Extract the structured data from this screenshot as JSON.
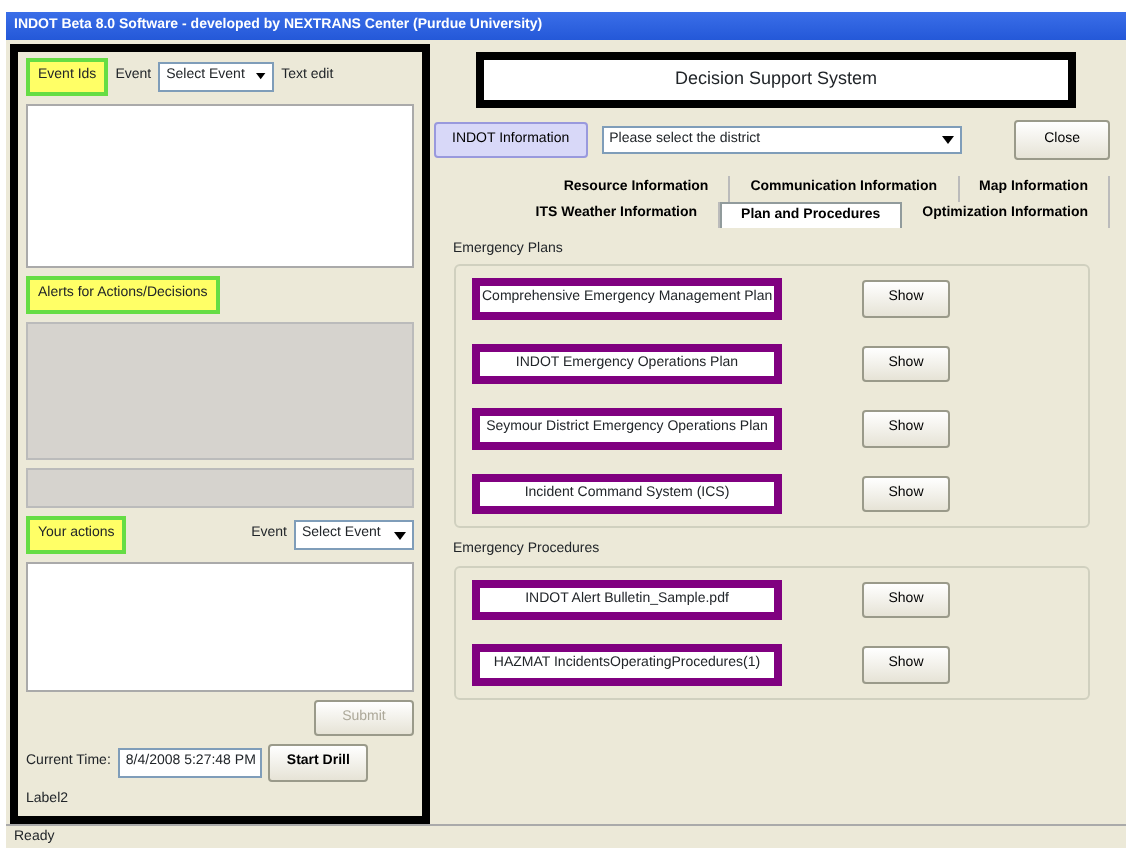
{
  "window": {
    "title": "INDOT Beta 8.0 Software - developed by NEXTRANS Center (Purdue University)"
  },
  "left_panel": {
    "events_label": "Event Ids",
    "event_label": "Event",
    "event_select": "Select Event",
    "text_label": "Text edit",
    "alerts_label": "Alerts for Actions/Decisions",
    "actions_label": "Your actions",
    "actions_event_label": "Event",
    "actions_event_select": "Select Event",
    "submit": {
      "label": "Submit",
      "disabled": true
    },
    "time_label": "Current Time:",
    "time_value": "8/4/2008 5:27:48 PM",
    "start_button": "Start Drill",
    "footer_label": "Label2"
  },
  "header": {
    "title": "Decision Support System",
    "info_button": "INDOT Information",
    "district_select": "Please select the district",
    "close_button": "Close"
  },
  "tab_rows": [
    [
      {
        "label": "Resource Information",
        "selected": false
      },
      {
        "label": "Communication Information",
        "selected": false
      },
      {
        "label": "Map Information",
        "selected": false
      }
    ],
    [
      {
        "label": "ITS Weather Information",
        "selected": false
      },
      {
        "label": "Plan and Procedures",
        "selected": true
      },
      {
        "label": "Optimization Information",
        "selected": false
      }
    ]
  ],
  "groups": [
    {
      "title": "Emergency Plans",
      "items": [
        {
          "name": "Comprehensive Emergency Management Plan",
          "button": "Show"
        },
        {
          "name": "INDOT Emergency Operations Plan",
          "button": "Show"
        },
        {
          "name": "Seymour District Emergency Operations Plan",
          "button": "Show"
        },
        {
          "name": "Incident Command System (ICS)",
          "button": "Show"
        }
      ]
    },
    {
      "title": "Emergency Procedures",
      "items": [
        {
          "name": "INDOT Alert Bulletin_Sample.pdf",
          "button": "Show"
        },
        {
          "name": "HAZMAT IncidentsOperatingProcedures(1)",
          "button": "Show"
        }
      ]
    }
  ],
  "status_bar": "Ready"
}
